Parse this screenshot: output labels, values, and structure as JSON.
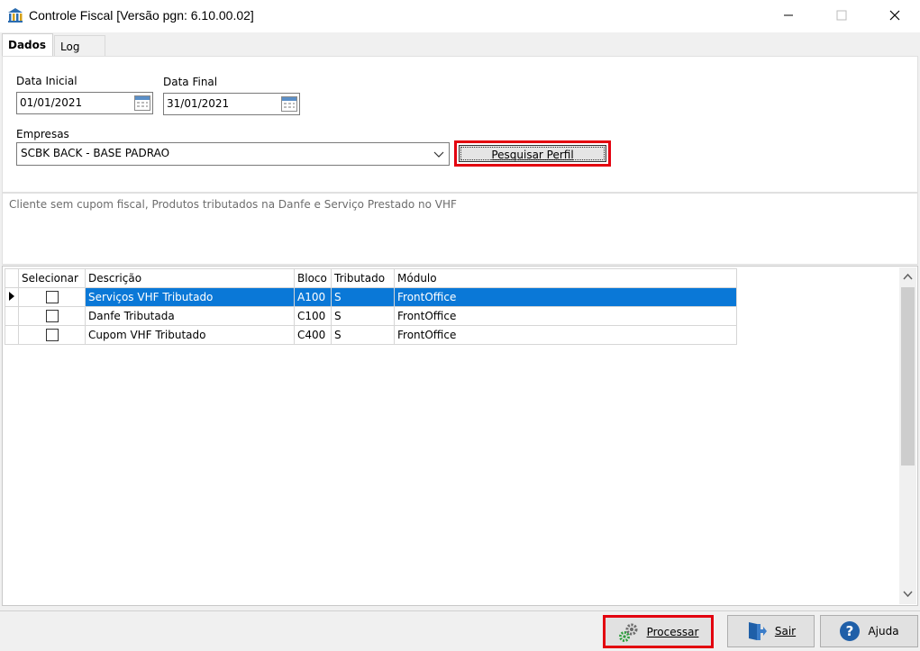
{
  "window": {
    "title": "Controle Fiscal [Versão pgn: 6.10.00.02]",
    "icon": "bank-building-icon"
  },
  "tabs": [
    {
      "label": "Dados",
      "active": true
    },
    {
      "label": "Log",
      "active": false
    }
  ],
  "filters": {
    "data_inicial_label": "Data Inicial",
    "data_inicial_value": "01/01/2021",
    "data_final_label": "Data Final",
    "data_final_value": "31/01/2021",
    "empresas_label": "Empresas",
    "empresas_value": "SCBK BACK - BASE PADRAO",
    "pesquisar_button": "Pesquisar Perfil"
  },
  "description": "Cliente sem cupom fiscal, Produtos tributados na Danfe e Serviço Prestado no VHF",
  "grid": {
    "columns": [
      "Selecionar",
      "Descrição",
      "Bloco",
      "Tributado",
      "Módulo"
    ],
    "rows": [
      {
        "selecionar": false,
        "descricao": "Serviços VHF Tributado",
        "bloco": "A100",
        "tributado": "S",
        "modulo": "FrontOffice",
        "selected": true
      },
      {
        "selecionar": false,
        "descricao": "Danfe Tributada",
        "bloco": "C100",
        "tributado": "S",
        "modulo": "FrontOffice",
        "selected": false
      },
      {
        "selecionar": false,
        "descricao": "Cupom VHF Tributado",
        "bloco": "C400",
        "tributado": "S",
        "modulo": "FrontOffice",
        "selected": false
      }
    ]
  },
  "footer": {
    "processar_label": "Processar",
    "sair_label": "Sair",
    "ajuda_label": "Ajuda"
  },
  "colors": {
    "selection": "#0a78d7",
    "highlight": "#e3000f"
  }
}
